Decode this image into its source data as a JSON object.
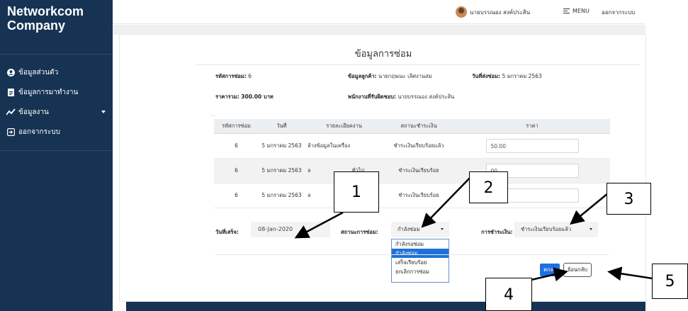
{
  "brand": {
    "line1": "Networkcom",
    "line2": "Company"
  },
  "sidebar": {
    "items": [
      {
        "label": "ข้อมูลส่วนตัว",
        "icon": "user-circle-icon"
      },
      {
        "label": "ข้อมูลการมาทำงาน",
        "icon": "id-card-icon"
      },
      {
        "label": "ข้อมูลงาน",
        "icon": "chart-line-icon"
      },
      {
        "label": "ออกจากระบบ",
        "icon": "sign-out-icon"
      }
    ]
  },
  "topbar": {
    "user": "นายบรรณอง สงค์ประสิน",
    "menu": "MENU",
    "logout": "ออกจากระบบ"
  },
  "main": {
    "title": "ข้อมูลการซ่อม",
    "info": {
      "repair_id_label": "รหัสการซ่อม:",
      "repair_id": "6",
      "customer_label": "ข้อมูลลูกค้า:",
      "customer": "นายกฤษณะ เลิศงานสม",
      "sent_date_label": "วันที่ส่งซ่อม:",
      "sent_date": "5 มกราคม 2563",
      "total_label": "ราคารวม: 300.00 บาท",
      "staff_label": "พนักงานที่รับผิดชอบ:",
      "staff": "นายบรรณอง สงค์ประสิน"
    },
    "dots": "...",
    "table": {
      "headers": [
        "รหัสการซ่อม",
        "วันที่",
        "รายละเอียดงาน",
        "สถานะชำระเงิน",
        "ราคา"
      ],
      "rows": [
        {
          "id": "6",
          "date": "5 มกราคม 2563",
          "desc": "ล้างข้อมูลในเครื่อง",
          "status": "ชำระเงินเรียบร้อยแล้ว",
          "price": "50.00"
        },
        {
          "id": "6",
          "date": "5 มกราคม 2563",
          "desc": "ล",
          "desc2": "ทั่วไป",
          "status": "ชำระเงินเรียบร้อย",
          "price": "00"
        },
        {
          "id": "6",
          "date": "5 มกราคม 2563",
          "desc": "ล",
          "desc2": "",
          "status": "ชำระเงินเรียบร้อย",
          "price": "00"
        }
      ]
    },
    "form": {
      "finish_label": "วันที่เสร็จ:",
      "finish_value": "08-Jan-2020",
      "repair_status_label": "สถานะการซ่อม:",
      "repair_status_value": "กำลังซ่อม",
      "repair_status_options": [
        "กำลังรอซ่อม",
        "กำลังซ่อม",
        "เสร็จเรียบร้อย",
        "ยกเลิกการซ่อม"
      ],
      "payment_label": "การชำระเงิน:",
      "payment_value": "ชำระเงินเรียบร้อยแล้ว"
    },
    "buttons": {
      "ok": "ตกลง",
      "back": "ย้อนกลับ"
    }
  },
  "callouts": [
    "1",
    "2",
    "3",
    "4",
    "5"
  ]
}
